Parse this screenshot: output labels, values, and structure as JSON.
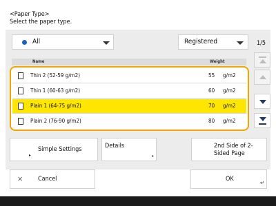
{
  "header": {
    "title": "<Paper Type>",
    "instruction": "Select the paper type."
  },
  "filter": {
    "selected": "All"
  },
  "registered": {
    "selected": "Registered"
  },
  "pager": {
    "label": "1/5"
  },
  "table": {
    "columns": [
      "Name",
      "Weight"
    ],
    "rows": [
      {
        "name": "Thin 2 (52-59 g/m2)",
        "weight": "55",
        "unit": "g/m2",
        "selected": false
      },
      {
        "name": "Thin 1 (60-63 g/m2)",
        "weight": "60",
        "unit": "g/m2",
        "selected": false
      },
      {
        "name": "Plain 1 (64-75 g/m2)",
        "weight": "70",
        "unit": "g/m2",
        "selected": true
      },
      {
        "name": "Plain 2 (76-90 g/m2)",
        "weight": "80",
        "unit": "g/m2",
        "selected": false
      }
    ]
  },
  "buttons": {
    "simple_settings": "Simple Settings",
    "details": "Details",
    "second_side": "2nd Side of 2-Sided Page",
    "cancel": "Cancel",
    "ok": "OK"
  },
  "colors": {
    "accent": "#f0a500",
    "selection": "#ffe600",
    "scroll_arrow": "#1f3b6b",
    "filter_dot": "#1565c0"
  }
}
